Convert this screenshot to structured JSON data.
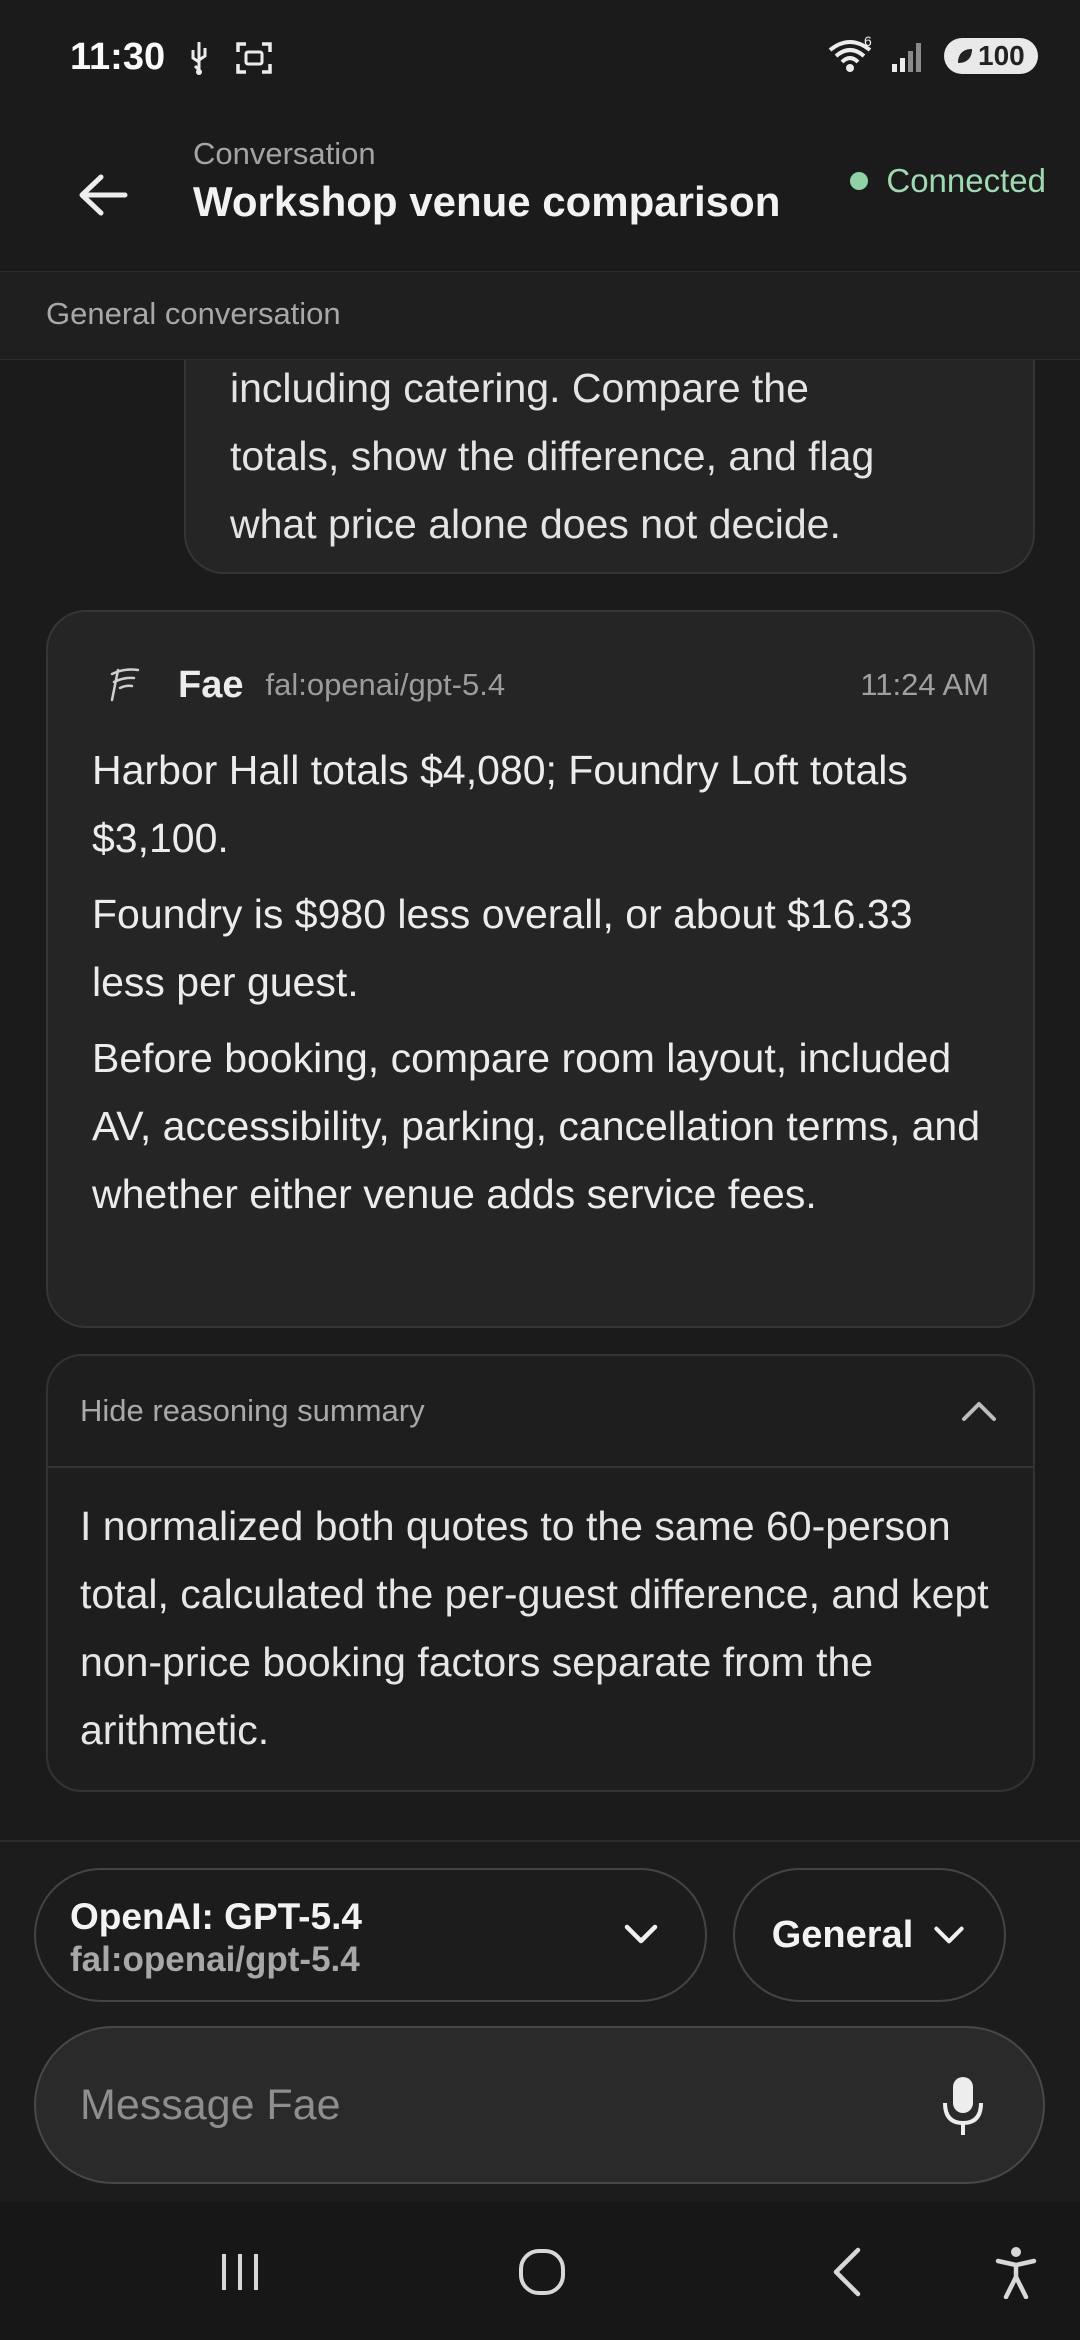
{
  "status_bar": {
    "time": "11:30",
    "network_badge": "6",
    "battery_level": "100"
  },
  "header": {
    "subtitle": "Conversation",
    "title": "Workshop venue comparison",
    "connection_status": "Connected",
    "connection_color": "#8fd3a4"
  },
  "mode_strip": {
    "label": "General conversation"
  },
  "user_message": {
    "lines": [
      "including catering. Compare the",
      "totals, show the difference, and flag",
      "what price alone does not decide."
    ]
  },
  "assistant_message": {
    "name": "Fae",
    "model": "fal:openai/gpt-5.4",
    "time": "11:24 AM",
    "paragraphs": [
      "Harbor Hall totals $4,080; Foundry Loft totals $3,100.",
      "Foundry is $980 less overall, or about $16.33 less per guest.",
      "Before booking, compare room layout, included AV, accessibility, parking, cancellation terms, and whether either venue adds service fees."
    ]
  },
  "reasoning": {
    "toggle_label": "Hide reasoning summary",
    "text": "I normalized both quotes to the same 60-person total, calculated the per-guest difference, and kept non-price booking factors separate from the arithmetic."
  },
  "composer": {
    "model_name": "OpenAI: GPT-5.4",
    "model_id": "fal:openai/gpt-5.4",
    "mode": "General",
    "placeholder": "Message Fae"
  },
  "icons": {
    "back": "arrow-left-icon",
    "chevron": "chevron-down-icon",
    "collapse": "chevron-up-icon",
    "mic": "microphone-icon"
  }
}
